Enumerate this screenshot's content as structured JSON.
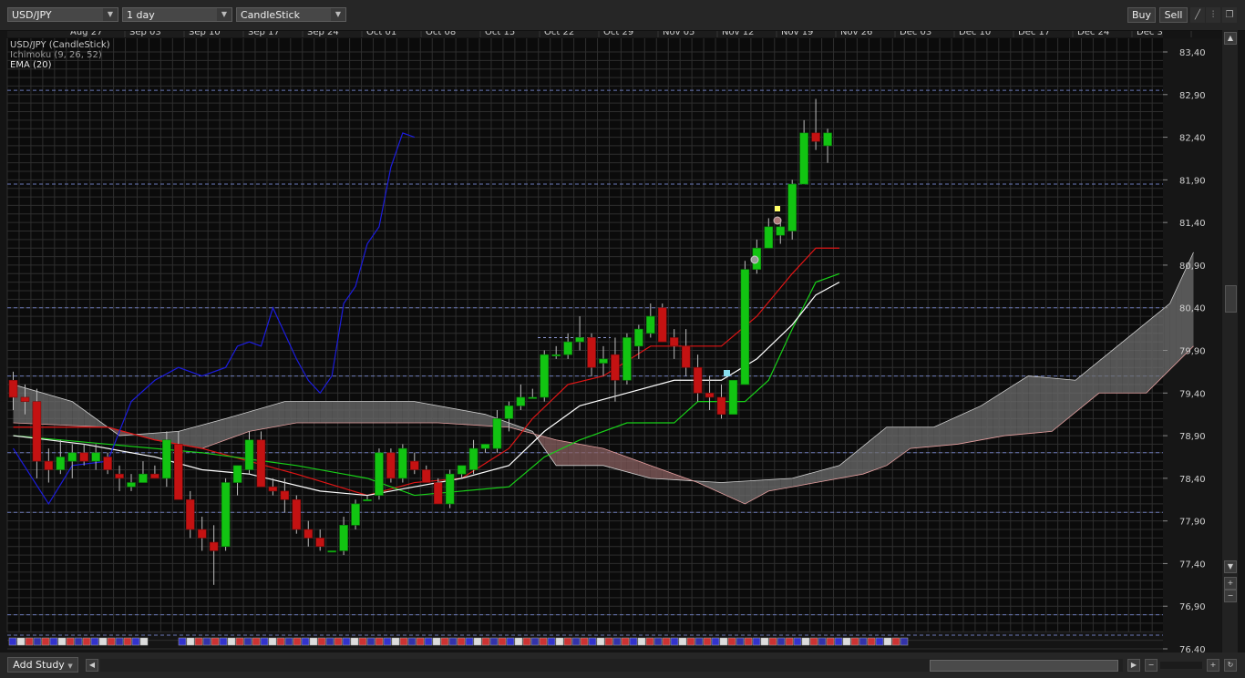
{
  "toolbar": {
    "symbol": "USD/JPY",
    "period": "1 day",
    "chart_type": "CandleStick",
    "buy_label": "Buy",
    "sell_label": "Sell"
  },
  "legend": {
    "line1": "USD/JPY (CandleStick)",
    "line2": "Ichimoku (9, 26, 52)",
    "line3": "EMA (20)"
  },
  "bottom": {
    "add_study_label": "Add Study"
  },
  "colors": {
    "background": "#141414",
    "grid": "#2e2e2e",
    "bull": "#12c412",
    "bear": "#c41212",
    "tenkan": "#e01515",
    "kijun": "#18d018",
    "chikou": "#1c1cdd",
    "ema": "#ffffff",
    "bull_cloud": "#6e6e6e",
    "bear_cloud": "#8a6060"
  },
  "chart_data": {
    "type": "candlestick",
    "x_tick_labels": [
      "Aug 27",
      "Sep 03",
      "Sep 10",
      "Sep 17",
      "Sep 24",
      "Oct 01",
      "Oct 08",
      "Oct 15",
      "Oct 22",
      "Oct 29",
      "Nov 05",
      "Nov 12",
      "Nov 19",
      "Nov 26",
      "Dec 03",
      "Dec 10",
      "Dec 17",
      "Dec 24",
      "Dec 3"
    ],
    "y_tick_labels": [
      "83,40",
      "82,90",
      "82,40",
      "81,90",
      "81,40",
      "80,90",
      "80,40",
      "79,90",
      "79,40",
      "78,90",
      "78,40",
      "77,90",
      "77,40",
      "76,90",
      "76,40"
    ],
    "ylim": [
      76.4,
      83.4
    ],
    "candles": [
      {
        "o": 79.55,
        "h": 79.65,
        "l": 79.2,
        "c": 79.35
      },
      {
        "o": 79.35,
        "h": 79.5,
        "l": 79.15,
        "c": 79.3
      },
      {
        "o": 79.3,
        "h": 79.45,
        "l": 78.4,
        "c": 78.6
      },
      {
        "o": 78.6,
        "h": 78.75,
        "l": 78.35,
        "c": 78.5
      },
      {
        "o": 78.5,
        "h": 78.85,
        "l": 78.45,
        "c": 78.65
      },
      {
        "o": 78.6,
        "h": 78.8,
        "l": 78.4,
        "c": 78.7
      },
      {
        "o": 78.7,
        "h": 78.8,
        "l": 78.55,
        "c": 78.6
      },
      {
        "o": 78.6,
        "h": 78.8,
        "l": 78.5,
        "c": 78.7
      },
      {
        "o": 78.65,
        "h": 78.7,
        "l": 78.45,
        "c": 78.5
      },
      {
        "o": 78.45,
        "h": 78.55,
        "l": 78.25,
        "c": 78.4
      },
      {
        "o": 78.3,
        "h": 78.45,
        "l": 78.25,
        "c": 78.35
      },
      {
        "o": 78.35,
        "h": 78.6,
        "l": 78.35,
        "c": 78.45
      },
      {
        "o": 78.45,
        "h": 78.55,
        "l": 78.4,
        "c": 78.4
      },
      {
        "o": 78.4,
        "h": 78.95,
        "l": 78.3,
        "c": 78.85
      },
      {
        "o": 78.8,
        "h": 78.95,
        "l": 78.2,
        "c": 78.15
      },
      {
        "o": 78.15,
        "h": 78.25,
        "l": 77.7,
        "c": 77.8
      },
      {
        "o": 77.8,
        "h": 77.95,
        "l": 77.55,
        "c": 77.7
      },
      {
        "o": 77.65,
        "h": 77.85,
        "l": 77.15,
        "c": 77.55
      },
      {
        "o": 77.6,
        "h": 78.4,
        "l": 77.55,
        "c": 78.35
      },
      {
        "o": 78.35,
        "h": 78.55,
        "l": 78.2,
        "c": 78.55
      },
      {
        "o": 78.5,
        "h": 78.95,
        "l": 78.45,
        "c": 78.85
      },
      {
        "o": 78.85,
        "h": 78.95,
        "l": 78.3,
        "c": 78.3
      },
      {
        "o": 78.3,
        "h": 78.4,
        "l": 78.2,
        "c": 78.25
      },
      {
        "o": 78.25,
        "h": 78.4,
        "l": 78.0,
        "c": 78.15
      },
      {
        "o": 78.15,
        "h": 78.2,
        "l": 77.75,
        "c": 77.8
      },
      {
        "o": 77.8,
        "h": 77.9,
        "l": 77.6,
        "c": 77.7
      },
      {
        "o": 77.7,
        "h": 77.8,
        "l": 77.55,
        "c": 77.6
      },
      {
        "o": 77.55,
        "h": 77.55,
        "l": 77.55,
        "c": 77.55
      },
      {
        "o": 77.55,
        "h": 77.95,
        "l": 77.5,
        "c": 77.85
      },
      {
        "o": 77.85,
        "h": 78.15,
        "l": 77.8,
        "c": 78.1
      },
      {
        "o": 78.15,
        "h": 78.2,
        "l": 78.15,
        "c": 78.15
      },
      {
        "o": 78.2,
        "h": 78.75,
        "l": 78.15,
        "c": 78.7
      },
      {
        "o": 78.7,
        "h": 78.75,
        "l": 78.35,
        "c": 78.4
      },
      {
        "o": 78.4,
        "h": 78.8,
        "l": 78.35,
        "c": 78.75
      },
      {
        "o": 78.6,
        "h": 78.7,
        "l": 78.45,
        "c": 78.5
      },
      {
        "o": 78.5,
        "h": 78.55,
        "l": 78.35,
        "c": 78.35
      },
      {
        "o": 78.35,
        "h": 78.4,
        "l": 78.1,
        "c": 78.1
      },
      {
        "o": 78.1,
        "h": 78.5,
        "l": 78.05,
        "c": 78.45
      },
      {
        "o": 78.45,
        "h": 78.55,
        "l": 78.4,
        "c": 78.55
      },
      {
        "o": 78.5,
        "h": 78.85,
        "l": 78.45,
        "c": 78.75
      },
      {
        "o": 78.75,
        "h": 78.8,
        "l": 78.7,
        "c": 78.8
      },
      {
        "o": 78.75,
        "h": 79.2,
        "l": 78.7,
        "c": 79.1
      },
      {
        "o": 79.1,
        "h": 79.3,
        "l": 78.95,
        "c": 79.25
      },
      {
        "o": 79.25,
        "h": 79.5,
        "l": 79.2,
        "c": 79.35
      },
      {
        "o": 79.35,
        "h": 79.45,
        "l": 79.35,
        "c": 79.35
      },
      {
        "o": 79.35,
        "h": 79.9,
        "l": 79.3,
        "c": 79.85
      },
      {
        "o": 79.85,
        "h": 79.95,
        "l": 79.8,
        "c": 79.85
      },
      {
        "o": 79.85,
        "h": 80.1,
        "l": 79.8,
        "c": 80.0
      },
      {
        "o": 80.0,
        "h": 80.3,
        "l": 79.9,
        "c": 80.05
      },
      {
        "o": 80.05,
        "h": 80.1,
        "l": 79.6,
        "c": 79.7
      },
      {
        "o": 79.75,
        "h": 79.95,
        "l": 79.6,
        "c": 79.8
      },
      {
        "o": 79.85,
        "h": 80.05,
        "l": 79.3,
        "c": 79.55
      },
      {
        "o": 79.55,
        "h": 80.1,
        "l": 79.5,
        "c": 80.05
      },
      {
        "o": 79.95,
        "h": 80.2,
        "l": 79.8,
        "c": 80.15
      },
      {
        "o": 80.1,
        "h": 80.45,
        "l": 80.05,
        "c": 80.3
      },
      {
        "o": 80.4,
        "h": 80.45,
        "l": 80.0,
        "c": 80.0
      },
      {
        "o": 80.05,
        "h": 80.15,
        "l": 79.8,
        "c": 79.95
      },
      {
        "o": 79.95,
        "h": 80.15,
        "l": 79.6,
        "c": 79.7
      },
      {
        "o": 79.7,
        "h": 79.85,
        "l": 79.3,
        "c": 79.4
      },
      {
        "o": 79.4,
        "h": 79.6,
        "l": 79.2,
        "c": 79.35
      },
      {
        "o": 79.35,
        "h": 79.5,
        "l": 79.1,
        "c": 79.15
      },
      {
        "o": 79.15,
        "h": 79.55,
        "l": 79.15,
        "c": 79.55
      },
      {
        "o": 79.5,
        "h": 80.95,
        "l": 79.5,
        "c": 80.85
      },
      {
        "o": 80.85,
        "h": 81.2,
        "l": 80.8,
        "c": 81.1
      },
      {
        "o": 81.1,
        "h": 81.45,
        "l": 81.1,
        "c": 81.35
      },
      {
        "o": 81.25,
        "h": 81.4,
        "l": 81.15,
        "c": 81.35
      },
      {
        "o": 81.3,
        "h": 81.9,
        "l": 81.2,
        "c": 81.85
      },
      {
        "o": 81.85,
        "h": 82.6,
        "l": 81.85,
        "c": 82.45
      },
      {
        "o": 82.45,
        "h": 82.85,
        "l": 82.25,
        "c": 82.35
      },
      {
        "o": 82.3,
        "h": 82.5,
        "l": 82.1,
        "c": 82.45
      }
    ],
    "tenkan": [
      [
        0,
        79.0
      ],
      [
        8,
        79.0
      ],
      [
        12,
        78.85
      ],
      [
        16,
        78.75
      ],
      [
        20,
        78.6
      ],
      [
        24,
        78.45
      ],
      [
        30,
        78.2
      ],
      [
        34,
        78.35
      ],
      [
        38,
        78.4
      ],
      [
        42,
        78.75
      ],
      [
        44,
        79.1
      ],
      [
        47,
        79.5
      ],
      [
        50,
        79.6
      ],
      [
        54,
        79.95
      ],
      [
        57,
        79.95
      ],
      [
        60,
        79.95
      ],
      [
        63,
        80.3
      ],
      [
        66,
        80.8
      ],
      [
        68,
        81.1
      ],
      [
        70,
        81.1
      ]
    ],
    "kijun": [
      [
        0,
        78.9
      ],
      [
        16,
        78.7
      ],
      [
        24,
        78.55
      ],
      [
        30,
        78.4
      ],
      [
        34,
        78.2
      ],
      [
        42,
        78.3
      ],
      [
        45,
        78.65
      ],
      [
        48,
        78.85
      ],
      [
        52,
        79.05
      ],
      [
        56,
        79.05
      ],
      [
        58,
        79.3
      ],
      [
        62,
        79.3
      ],
      [
        64,
        79.55
      ],
      [
        66,
        80.15
      ],
      [
        68,
        80.7
      ],
      [
        70,
        80.8
      ]
    ],
    "ema": [
      [
        0,
        78.9
      ],
      [
        6,
        78.8
      ],
      [
        12,
        78.65
      ],
      [
        16,
        78.5
      ],
      [
        20,
        78.45
      ],
      [
        26,
        78.25
      ],
      [
        30,
        78.2
      ],
      [
        34,
        78.3
      ],
      [
        38,
        78.4
      ],
      [
        42,
        78.55
      ],
      [
        45,
        78.95
      ],
      [
        48,
        79.25
      ],
      [
        52,
        79.4
      ],
      [
        56,
        79.55
      ],
      [
        60,
        79.55
      ],
      [
        63,
        79.8
      ],
      [
        66,
        80.2
      ],
      [
        68,
        80.55
      ],
      [
        70,
        80.7
      ]
    ],
    "chikou": [
      [
        0,
        78.75
      ],
      [
        3,
        78.1
      ],
      [
        5,
        78.55
      ],
      [
        8,
        78.6
      ],
      [
        10,
        79.3
      ],
      [
        12,
        79.55
      ],
      [
        14,
        79.7
      ],
      [
        16,
        79.6
      ],
      [
        18,
        79.7
      ],
      [
        19,
        79.95
      ],
      [
        20,
        80.0
      ],
      [
        21,
        79.95
      ],
      [
        22,
        80.4
      ],
      [
        23,
        80.1
      ],
      [
        24,
        79.8
      ],
      [
        25,
        79.55
      ],
      [
        26,
        79.4
      ],
      [
        27,
        79.6
      ],
      [
        28,
        80.45
      ],
      [
        29,
        80.65
      ],
      [
        30,
        81.15
      ],
      [
        31,
        81.35
      ],
      [
        32,
        82.05
      ],
      [
        33,
        82.45
      ],
      [
        34,
        82.4
      ]
    ],
    "cloud_a": [
      [
        0,
        79.5
      ],
      [
        5,
        79.3
      ],
      [
        9,
        78.9
      ],
      [
        14,
        78.95
      ],
      [
        18,
        79.1
      ],
      [
        23,
        79.3
      ],
      [
        28,
        79.3
      ],
      [
        34,
        79.3
      ],
      [
        40,
        79.15
      ],
      [
        44,
        78.95
      ],
      [
        46,
        78.55
      ],
      [
        50,
        78.55
      ],
      [
        54,
        78.4
      ],
      [
        60,
        78.35
      ],
      [
        66,
        78.4
      ],
      [
        70,
        78.55
      ],
      [
        74,
        79.0
      ],
      [
        78,
        79.0
      ],
      [
        82,
        79.25
      ],
      [
        86,
        79.6
      ],
      [
        90,
        79.55
      ],
      [
        94,
        80.0
      ],
      [
        98,
        80.45
      ],
      [
        100,
        81.05
      ]
    ],
    "cloud_b": [
      [
        0,
        79.05
      ],
      [
        8,
        79.0
      ],
      [
        12,
        78.85
      ],
      [
        16,
        78.75
      ],
      [
        20,
        78.95
      ],
      [
        24,
        79.05
      ],
      [
        30,
        79.05
      ],
      [
        36,
        79.05
      ],
      [
        42,
        79.0
      ],
      [
        46,
        78.85
      ],
      [
        50,
        78.75
      ],
      [
        54,
        78.55
      ],
      [
        58,
        78.35
      ],
      [
        62,
        78.1
      ],
      [
        64,
        78.25
      ],
      [
        66,
        78.3
      ],
      [
        72,
        78.45
      ],
      [
        74,
        78.55
      ],
      [
        76,
        78.75
      ],
      [
        80,
        78.8
      ],
      [
        84,
        78.9
      ],
      [
        88,
        78.95
      ],
      [
        92,
        79.4
      ],
      [
        96,
        79.4
      ],
      [
        100,
        79.95
      ]
    ]
  }
}
